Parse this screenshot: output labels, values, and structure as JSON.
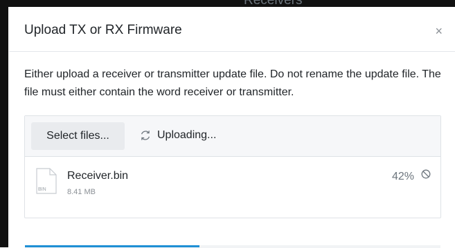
{
  "backdrop": {
    "text": "Receivers"
  },
  "modal": {
    "title": "Upload TX or RX Firmware",
    "close_label": "×",
    "description": "Either upload a receiver or transmitter update file. Do not rename the update file. The file must either contain the word receiver or transmitter."
  },
  "upload": {
    "select_label": "Select files...",
    "status_label": "Uploading...",
    "file": {
      "name": "Receiver.bin",
      "size": "8.41 MB",
      "icon_text": "BIN",
      "progress_text": "42%",
      "progress": 0.42
    }
  },
  "colors": {
    "accent": "#1e8fd5"
  }
}
